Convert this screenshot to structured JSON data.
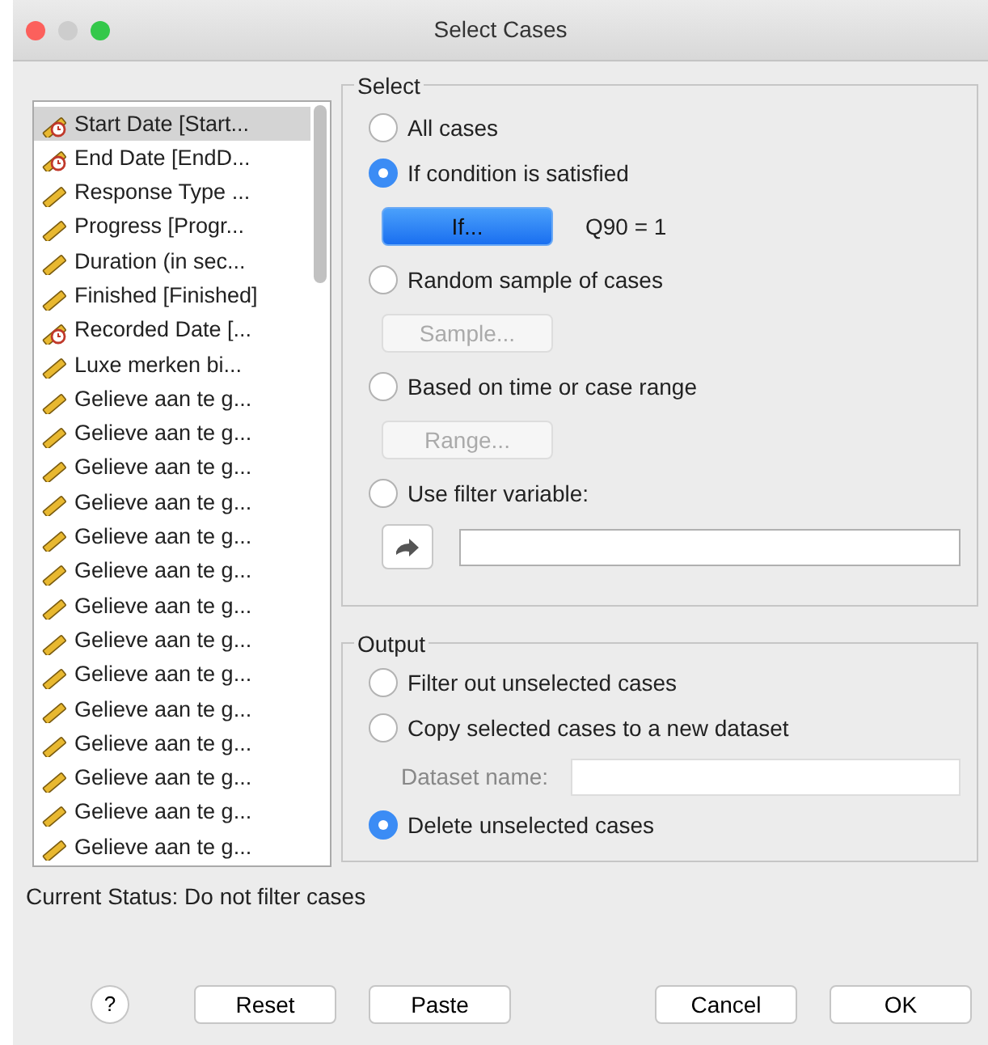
{
  "window": {
    "title": "Select Cases"
  },
  "variables": [
    {
      "label": "Start Date [Start...",
      "kind": "date",
      "selected": true
    },
    {
      "label": "End Date [EndD...",
      "kind": "date",
      "selected": false
    },
    {
      "label": "Response Type ...",
      "kind": "scale",
      "selected": false
    },
    {
      "label": "Progress [Progr...",
      "kind": "scale",
      "selected": false
    },
    {
      "label": "Duration (in sec...",
      "kind": "scale",
      "selected": false
    },
    {
      "label": "Finished [Finished]",
      "kind": "scale",
      "selected": false
    },
    {
      "label": "Recorded Date [...",
      "kind": "date",
      "selected": false
    },
    {
      "label": "Luxe merken bi...",
      "kind": "scale",
      "selected": false
    },
    {
      "label": "Gelieve aan te g...",
      "kind": "scale",
      "selected": false
    },
    {
      "label": "Gelieve aan te g...",
      "kind": "scale",
      "selected": false
    },
    {
      "label": "Gelieve aan te g...",
      "kind": "scale",
      "selected": false
    },
    {
      "label": "Gelieve aan te g...",
      "kind": "scale",
      "selected": false
    },
    {
      "label": "Gelieve aan te g...",
      "kind": "scale",
      "selected": false
    },
    {
      "label": "Gelieve aan te g...",
      "kind": "scale",
      "selected": false
    },
    {
      "label": "Gelieve aan te g...",
      "kind": "scale",
      "selected": false
    },
    {
      "label": "Gelieve aan te g...",
      "kind": "scale",
      "selected": false
    },
    {
      "label": "Gelieve aan te g...",
      "kind": "scale",
      "selected": false
    },
    {
      "label": "Gelieve aan te g...",
      "kind": "scale",
      "selected": false
    },
    {
      "label": "Gelieve aan te g...",
      "kind": "scale",
      "selected": false
    },
    {
      "label": "Gelieve aan te g...",
      "kind": "scale",
      "selected": false
    },
    {
      "label": "Gelieve aan te g...",
      "kind": "scale",
      "selected": false
    },
    {
      "label": "Gelieve aan te g...",
      "kind": "scale",
      "selected": false
    }
  ],
  "select": {
    "title": "Select",
    "options": [
      {
        "label": "All cases",
        "selected": false,
        "kind": "plain"
      },
      {
        "label": "If condition is satisfied",
        "selected": true,
        "kind": "button",
        "button": {
          "label": "If...",
          "primary": true,
          "disabled": false
        },
        "condition": "Q90 = 1"
      },
      {
        "label": "Random sample of cases",
        "selected": false,
        "kind": "button",
        "button": {
          "label": "Sample...",
          "primary": false,
          "disabled": true
        }
      },
      {
        "label": "Based on time or case range",
        "selected": false,
        "kind": "button",
        "button": {
          "label": "Range...",
          "primary": false,
          "disabled": true
        }
      },
      {
        "label": "Use filter variable:",
        "selected": false,
        "kind": "filter"
      }
    ]
  },
  "output": {
    "title": "Output",
    "options": [
      {
        "label": "Filter out unselected cases",
        "selected": false
      },
      {
        "label": "Copy selected cases to a new dataset",
        "selected": false,
        "field": {
          "label": "Dataset name:",
          "disabled": true
        }
      },
      {
        "label": "Delete unselected cases",
        "selected": true
      }
    ]
  },
  "status": "Current Status: Do not filter cases",
  "buttons": [
    {
      "label": "?",
      "kind": "help"
    },
    {
      "label": "Reset",
      "kind": "left"
    },
    {
      "label": "Paste",
      "kind": "left"
    },
    {
      "label": "Cancel",
      "kind": "right"
    },
    {
      "label": "OK",
      "kind": "right"
    }
  ]
}
